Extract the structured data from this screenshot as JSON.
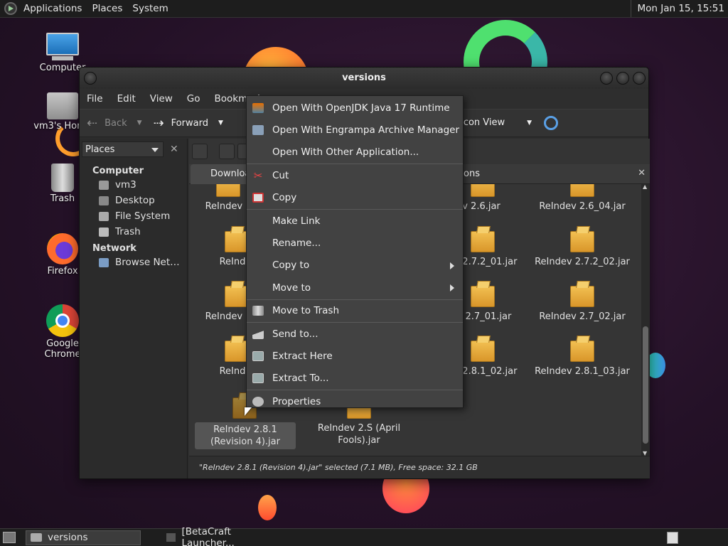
{
  "topbar": {
    "menus": [
      "Applications",
      "Places",
      "System"
    ],
    "clock": "Mon Jan 15, 15:51"
  },
  "desktop": {
    "icons": [
      {
        "label": "Computer",
        "icon": "computer-icon"
      },
      {
        "label": "vm3's Home",
        "icon": "home-folder-icon"
      },
      {
        "label": "Trash",
        "icon": "trash-icon"
      },
      {
        "label": "Firefox",
        "icon": "firefox-icon"
      },
      {
        "label": "Google Chrome",
        "icon": "chrome-icon"
      }
    ]
  },
  "window": {
    "title": "versions",
    "menubar": [
      "File",
      "Edit",
      "View",
      "Go",
      "Bookmarks"
    ],
    "toolbar": {
      "back": "Back",
      "forward": "Forward",
      "view_mode": "Icon View"
    },
    "sidebar": {
      "selector": "Places",
      "sections": [
        {
          "title": "Computer",
          "items": [
            {
              "label": "vm3",
              "icon": "home-icon"
            },
            {
              "label": "Desktop",
              "icon": "desktop-icon"
            },
            {
              "label": "File System",
              "icon": "drive-icon"
            },
            {
              "label": "Trash",
              "icon": "trash-icon"
            }
          ]
        },
        {
          "title": "Network",
          "items": [
            {
              "label": "Browse Net…",
              "icon": "network-icon"
            }
          ]
        }
      ]
    },
    "tab": {
      "label": "Downloa",
      "trailing": "ons"
    },
    "files": [
      {
        "name": "ReIndev 2",
        "visible_name": "ReIndev 2"
      },
      {
        "name": "ReIndev 2.6.jar",
        "visible_name": "v 2.6.jar"
      },
      {
        "name": "ReIndev 2.6_04.jar",
        "visible_name": "ReIndev 2.6_04.jar"
      },
      {
        "name": "ReIndev",
        "visible_name": "ReInde"
      },
      {
        "name": "ReIndev 2.7.2_01.jar",
        "visible_name": "v 2.7.2_01.jar"
      },
      {
        "name": "ReIndev 2.7.2_02.jar",
        "visible_name": "ReIndev 2.7.2_02.jar"
      },
      {
        "name": "ReIndev 2",
        "visible_name": "ReIndev 2"
      },
      {
        "name": "ReIndev 2.7_01.jar",
        "visible_name": "v 2.7_01.jar"
      },
      {
        "name": "ReIndev 2.7_02.jar",
        "visible_name": "ReIndev 2.7_02.jar"
      },
      {
        "name": "ReIndev",
        "visible_name": "ReInde"
      },
      {
        "name": "ReIndev 2.8.1_02.jar",
        "visible_name": "v 2.8.1_02.jar"
      },
      {
        "name": "ReIndev 2.8.1_03.jar",
        "visible_name": "ReIndev 2.8.1_03.jar"
      },
      {
        "name": "ReIndev 2.8.1 (Revision 4).jar",
        "visible_name": "ReIndev 2.8.1 (Revision 4).jar"
      },
      {
        "name": "ReIndev 2.S (April Fools).jar",
        "visible_name": "ReIndev 2.S (April Fools).jar"
      }
    ],
    "status": "\"ReIndev 2.8.1 (Revision 4).jar\" selected (7.1 MB), Free space: 32.1 GB"
  },
  "context_menu": {
    "items": [
      {
        "label": "Open With OpenJDK Java 17 Runtime",
        "icon": "java-icon"
      },
      {
        "label": "Open With Engrampa Archive Manager",
        "icon": "archive-manager-icon"
      },
      {
        "label": "Open With Other Application...",
        "icon": ""
      },
      {
        "label": "Cut",
        "icon": "cut-icon"
      },
      {
        "label": "Copy",
        "icon": "copy-icon"
      },
      {
        "label": "Make Link",
        "icon": ""
      },
      {
        "label": "Rename...",
        "icon": ""
      },
      {
        "label": "Copy to",
        "icon": "",
        "submenu": true
      },
      {
        "label": "Move to",
        "icon": "",
        "submenu": true
      },
      {
        "label": "Move to Trash",
        "icon": "trash-icon"
      },
      {
        "label": "Send to...",
        "icon": "send-icon"
      },
      {
        "label": "Extract Here",
        "icon": "extract-icon"
      },
      {
        "label": "Extract To...",
        "icon": "extract-icon"
      },
      {
        "label": "Properties",
        "icon": "properties-icon"
      }
    ]
  },
  "taskbar": {
    "tasks": [
      "versions",
      "[BetaCraft Launcher..."
    ]
  }
}
